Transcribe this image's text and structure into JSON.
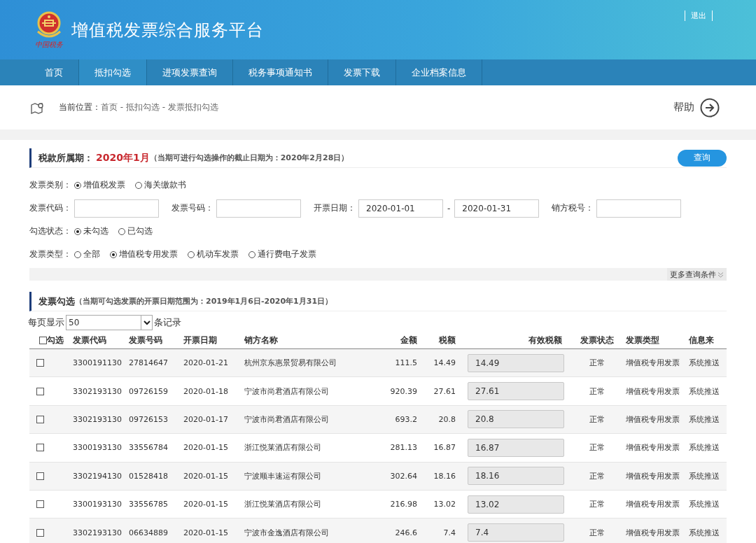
{
  "header": {
    "logo_text": "中国税务",
    "title": "增值税发票综合服务平台",
    "logout": "退出"
  },
  "nav": [
    {
      "label": "首页",
      "selected": false
    },
    {
      "label": "抵扣勾选",
      "selected": true
    },
    {
      "label": "进项发票查询",
      "selected": false
    },
    {
      "label": "税务事项通知书",
      "selected": false
    },
    {
      "label": "发票下载",
      "selected": false
    },
    {
      "label": "企业档案信息",
      "selected": false
    }
  ],
  "breadcrumb": {
    "label": "当前位置：",
    "path": "首页 - 抵扣勾选 - 发票抵扣勾选"
  },
  "help": "帮助",
  "period": {
    "label": "税款所属期：",
    "value": "2020年1月",
    "note": "（当期可进行勾选操作的截止日期为：2020年2月28日）",
    "query_button": "查询"
  },
  "filters": {
    "invoice_category": {
      "label": "发票类别：",
      "options": [
        {
          "label": "增值税发票",
          "selected": true
        },
        {
          "label": "海关缴款书",
          "selected": false
        }
      ]
    },
    "fields": [
      {
        "label": "发票代码："
      },
      {
        "label": "发票号码："
      },
      {
        "label": "开票日期：",
        "value": "2020-01-01",
        "separator": "-",
        "value2": "2020-01-31"
      },
      {
        "label": "销方税号："
      }
    ],
    "check_status": {
      "label": "勾选状态：",
      "options": [
        {
          "label": "未勾选",
          "selected": true
        },
        {
          "label": "已勾选",
          "selected": false
        }
      ]
    },
    "invoice_type": {
      "label": "发票类型：",
      "options": [
        {
          "label": "全部",
          "selected": false
        },
        {
          "label": "增值税专用发票",
          "selected": true
        },
        {
          "label": "机动车发票",
          "selected": false
        },
        {
          "label": "通行费电子发票",
          "selected": false
        }
      ]
    },
    "more": "更多查询条件"
  },
  "selection": {
    "title": "发票勾选",
    "note": "（当期可勾选发票的开票日期范围为：2019年1月6日-2020年1月31日）",
    "page_size_label": "每页显示",
    "page_size": "50",
    "page_size_suffix": "条记录"
  },
  "table": {
    "select_all": {
      "label": "勾选",
      "checked": false
    },
    "columns": [
      "发票代码",
      "发票号码",
      "开票日期",
      "销方名称",
      "金额",
      "税额",
      "有效税额",
      "发票状态",
      "发票类型",
      "信息来"
    ],
    "rows": [
      {
        "checked": false,
        "cells": [
          "3300191130",
          "27814647",
          "2020-01-21",
          "杭州京东惠景贸易有限公司",
          "111.5",
          "14.49",
          "14.49",
          "正常",
          "增值税专用发票",
          "系统推送"
        ]
      },
      {
        "checked": false,
        "cells": [
          "3302193130",
          "09726159",
          "2020-01-18",
          "宁波市尚君酒店有限公司",
          "920.39",
          "27.61",
          "27.61",
          "正常",
          "增值税专用发票",
          "系统推送"
        ]
      },
      {
        "checked": false,
        "cells": [
          "3302193130",
          "09726153",
          "2020-01-17",
          "宁波市尚君酒店有限公司",
          "693.2",
          "20.8",
          "20.8",
          "正常",
          "增值税专用发票",
          "系统推送"
        ]
      },
      {
        "checked": false,
        "cells": [
          "3300193130",
          "33556784",
          "2020-01-15",
          "浙江悦莱酒店有限公司",
          "281.13",
          "16.87",
          "16.87",
          "正常",
          "增值税专用发票",
          "系统推送"
        ]
      },
      {
        "checked": false,
        "cells": [
          "3302194130",
          "01528418",
          "2020-01-15",
          "宁波顺丰速运有限公司",
          "302.64",
          "18.16",
          "18.16",
          "正常",
          "增值税专用发票",
          "系统推送"
        ]
      },
      {
        "checked": false,
        "cells": [
          "3300193130",
          "33556785",
          "2020-01-15",
          "浙江悦莱酒店有限公司",
          "216.98",
          "13.02",
          "13.02",
          "正常",
          "增值税专用发票",
          "系统推送"
        ]
      },
      {
        "checked": false,
        "cells": [
          "3302193130",
          "06634889",
          "2020-01-15",
          "宁波市金逸酒店有限公司",
          "246.6",
          "7.4",
          "7.4",
          "正常",
          "增值税专用发票",
          "系统推送"
        ]
      }
    ]
  }
}
